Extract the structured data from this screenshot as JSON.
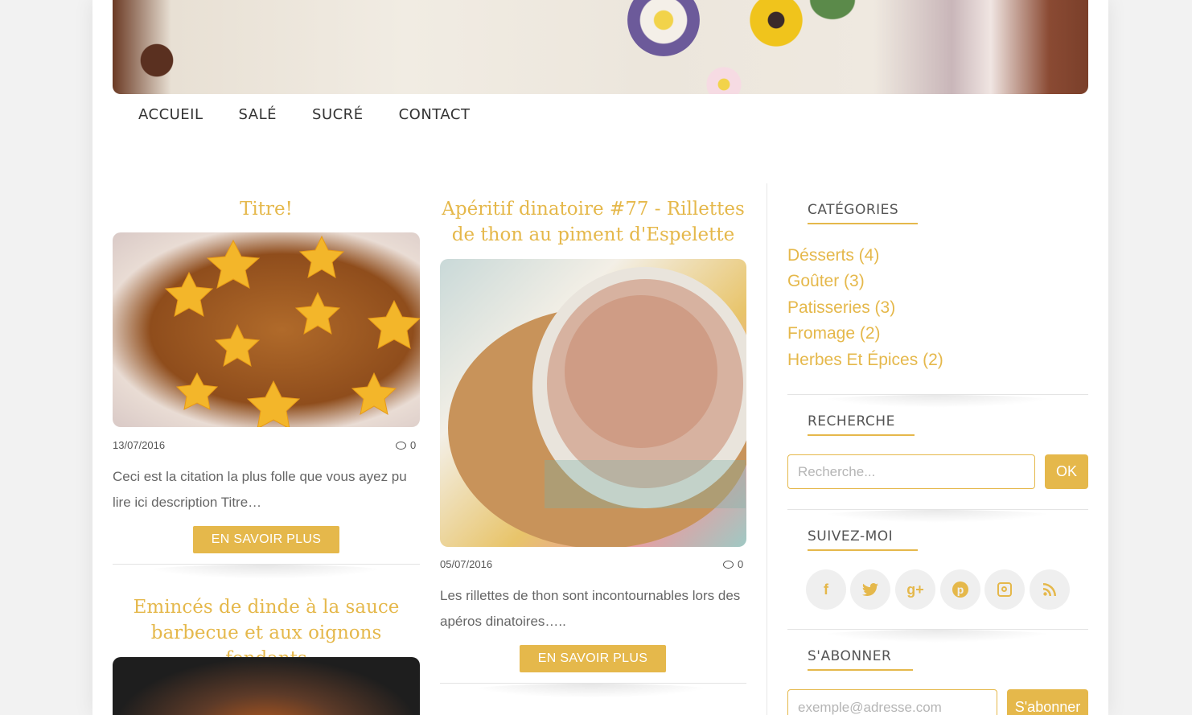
{
  "nav": {
    "items": [
      "ACCUEIL",
      "SALÉ",
      "SUCRÉ",
      "CONTACT"
    ]
  },
  "posts": [
    {
      "title": "Titre!",
      "date": "13/07/2016",
      "comments": "0",
      "excerpt": "Ceci est la citation la plus folle que vous ayez pu lire ici description Titre…",
      "button": "EN SAVOIR PLUS"
    },
    {
      "title_line1": "Apéritif dinatoire #77 - Rillettes",
      "title_line2": "de thon au piment d'Espelette",
      "date": "05/07/2016",
      "comments": "0",
      "excerpt": "Les rillettes de thon sont incontournables lors des apéros dinatoires…..",
      "button": "EN SAVOIR PLUS"
    },
    {
      "title_line1": "Emincés de dinde à la sauce",
      "title_line2": "barbecue et aux oignons fondants"
    }
  ],
  "sidebar": {
    "categories_title": "CATÉGORIES",
    "categories": [
      "Désserts (4)",
      "Goûter (3)",
      "Patisseries (3)",
      "Fromage (2)",
      "Herbes Et Épices (2)"
    ],
    "search_title": "RECHERCHE",
    "search_placeholder": "Recherche...",
    "search_button": "OK",
    "follow_title": "SUIVEZ-MOI",
    "social_icons": [
      "facebook-icon",
      "twitter-icon",
      "google-plus-icon",
      "pinterest-icon",
      "instagram-icon",
      "rss-icon"
    ],
    "subscribe_title": "S'ABONNER",
    "subscribe_placeholder": "exemple@adresse.com",
    "subscribe_button": "S'abonner"
  },
  "colors": {
    "accent": "#e5b84b",
    "text": "#333333"
  }
}
